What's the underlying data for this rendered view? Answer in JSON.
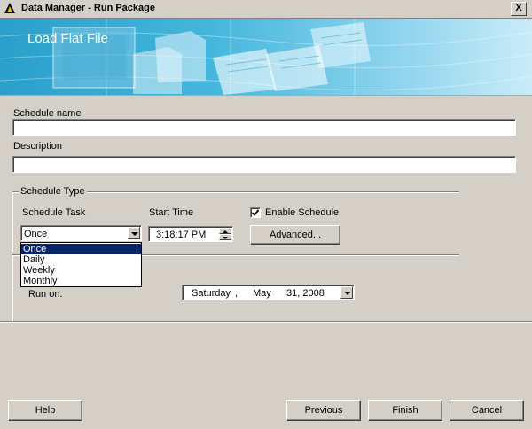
{
  "window": {
    "title": "Data Manager - Run Package",
    "close_glyph": "X"
  },
  "banner": {
    "title": "Load Flat File"
  },
  "form": {
    "schedule_name_label": "Schedule name",
    "schedule_name_value": "",
    "description_label": "Description",
    "description_value": ""
  },
  "schedule_type": {
    "group_label": "Schedule Type",
    "task_label": "Schedule Task",
    "task_selected": "Once",
    "task_options": [
      "Once",
      "Daily",
      "Weekly",
      "Monthly"
    ],
    "start_time_label": "Start Time",
    "start_time_value": "3:18:17 PM",
    "enable_schedule_label": "Enable Schedule",
    "enable_schedule_checked": true,
    "advanced_button": "Advanced..."
  },
  "run_on": {
    "label": "Run on:",
    "weekday": "Saturday",
    "separator": ",",
    "month": "May",
    "day_year": "31, 2008"
  },
  "footer": {
    "help": "Help",
    "previous": "Previous",
    "finish": "Finish",
    "cancel": "Cancel"
  },
  "colors": {
    "banner_start": "#2a9fc9",
    "banner_end": "#c9ecf8",
    "selection": "#0a246a",
    "dialog_bg": "#d4d0c8"
  }
}
